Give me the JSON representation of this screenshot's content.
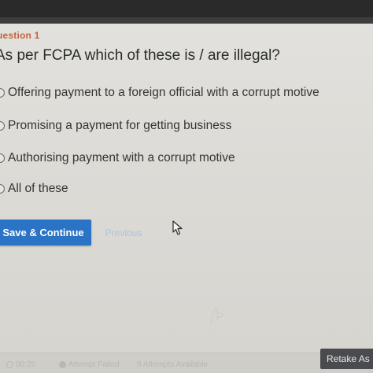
{
  "question": {
    "label": "uestion 1",
    "text": "As per FCPA which of these is / are illegal?"
  },
  "options": [
    {
      "label": "Offering payment to a foreign official with a corrupt motive"
    },
    {
      "label": "Promising a payment for getting business"
    },
    {
      "label": "Authorising payment with a corrupt motive"
    },
    {
      "label": "All of these"
    }
  ],
  "actions": {
    "primary_label": "Save & Continue",
    "secondary_label": "Previous"
  },
  "footer": {
    "timer": "00:25",
    "attempt_status": "Attempt Failed",
    "attempts_available": "9 Attempts Available",
    "retake_label": "Retake As"
  },
  "colors": {
    "accent": "#2b73c4",
    "question_label": "#c0653a"
  },
  "icons": {
    "cursor": "mouse-pointer-icon",
    "timer": "clock-icon"
  }
}
